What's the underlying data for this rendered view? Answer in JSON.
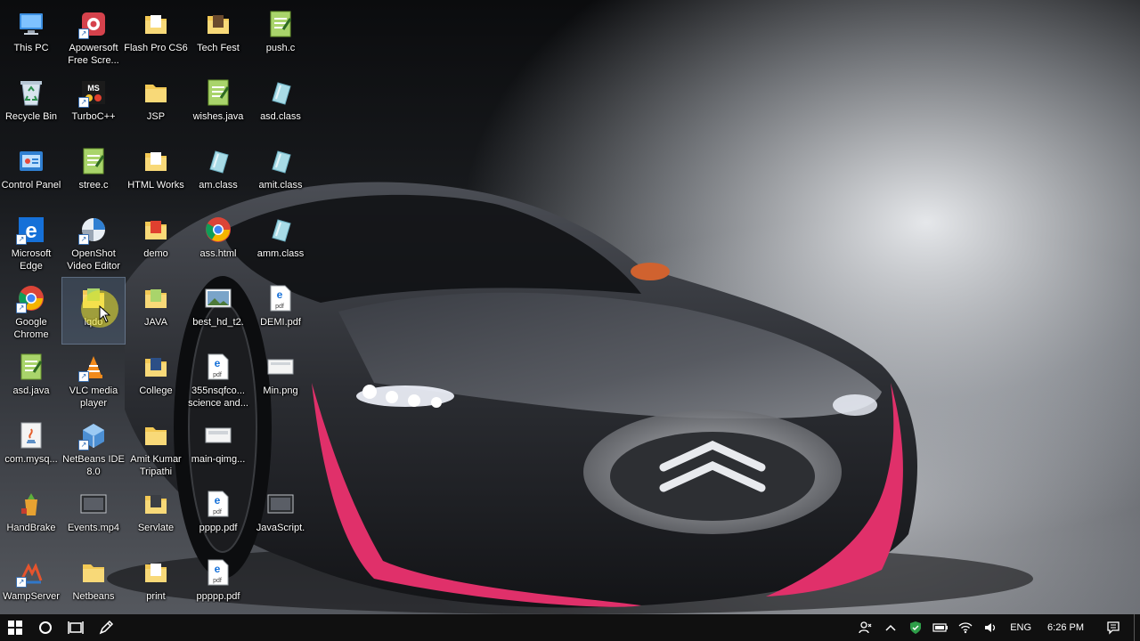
{
  "desktop": {
    "icons": [
      {
        "label": "This PC",
        "icon": "this-pc-icon"
      },
      {
        "label": "Recycle Bin",
        "icon": "recycle-bin-icon"
      },
      {
        "label": "Control Panel",
        "icon": "control-panel-icon"
      },
      {
        "label": "Microsoft Edge",
        "icon": "edge-icon"
      },
      {
        "label": "Google Chrome",
        "icon": "chrome-icon"
      },
      {
        "label": "asd.java",
        "icon": "notepadpp-file-icon"
      },
      {
        "label": "com.mysq...",
        "icon": "java-file-icon"
      },
      {
        "label": "HandBrake",
        "icon": "handbrake-icon"
      },
      {
        "label": "WampServer",
        "icon": "wampserver-icon"
      },
      {
        "label": "Apowersoft Free Scre...",
        "icon": "apowersoft-icon"
      },
      {
        "label": "TurboC++",
        "icon": "turboc-icon"
      },
      {
        "label": "stree.c",
        "icon": "notepadpp-file-icon"
      },
      {
        "label": "OpenShot Video Editor",
        "icon": "openshot-icon"
      },
      {
        "label": "lqdo",
        "icon": "folder-icon"
      },
      {
        "label": "VLC media player",
        "icon": "vlc-icon"
      },
      {
        "label": "NetBeans IDE 8.0",
        "icon": "netbeans-icon"
      },
      {
        "label": "Events.mp4",
        "icon": "video-file-icon"
      },
      {
        "label": "Netbeans",
        "icon": "folder-icon"
      },
      {
        "label": "Flash Pro CS6",
        "icon": "folder-icon"
      },
      {
        "label": "JSP",
        "icon": "folder-icon"
      },
      {
        "label": "HTML Works",
        "icon": "folder-icon"
      },
      {
        "label": "demo",
        "icon": "folder-icon"
      },
      {
        "label": "JAVA",
        "icon": "folder-icon"
      },
      {
        "label": "College",
        "icon": "folder-icon"
      },
      {
        "label": "Amit Kumar Tripathi",
        "icon": "folder-icon"
      },
      {
        "label": "Servlate",
        "icon": "folder-icon"
      },
      {
        "label": "print",
        "icon": "folder-icon"
      },
      {
        "label": "Tech Fest",
        "icon": "folder-icon"
      },
      {
        "label": "wishes.java",
        "icon": "notepadpp-file-icon"
      },
      {
        "label": "am.class",
        "icon": "class-file-icon"
      },
      {
        "label": "ass.html",
        "icon": "chrome-icon"
      },
      {
        "label": "best_hd_t2.",
        "icon": "image-file-icon"
      },
      {
        "label": "355nsqfco... science and...",
        "icon": "pdf-file-icon"
      },
      {
        "label": "main-qimg...",
        "icon": "image-file-icon"
      },
      {
        "label": "pppp.pdf",
        "icon": "pdf-file-icon"
      },
      {
        "label": "ppppp.pdf",
        "icon": "pdf-file-icon"
      },
      {
        "label": "push.c",
        "icon": "notepadpp-file-icon"
      },
      {
        "label": "asd.class",
        "icon": "class-file-icon"
      },
      {
        "label": "amit.class",
        "icon": "class-file-icon"
      },
      {
        "label": "amm.class",
        "icon": "class-file-icon"
      },
      {
        "label": "DEMI.pdf",
        "icon": "pdf-file-icon"
      },
      {
        "label": "Min.png",
        "icon": "image-file-icon"
      },
      {
        "label": "JavaScript.",
        "icon": "video-file-icon"
      }
    ]
  },
  "taskbar": {
    "start_icon": "windows-logo-icon",
    "search_icon": "cortana-icon",
    "task_view_icon": "task-view-icon",
    "pinned_icon": "pen-icon",
    "tray": {
      "language": "ENG",
      "time": "6:26 PM"
    }
  }
}
